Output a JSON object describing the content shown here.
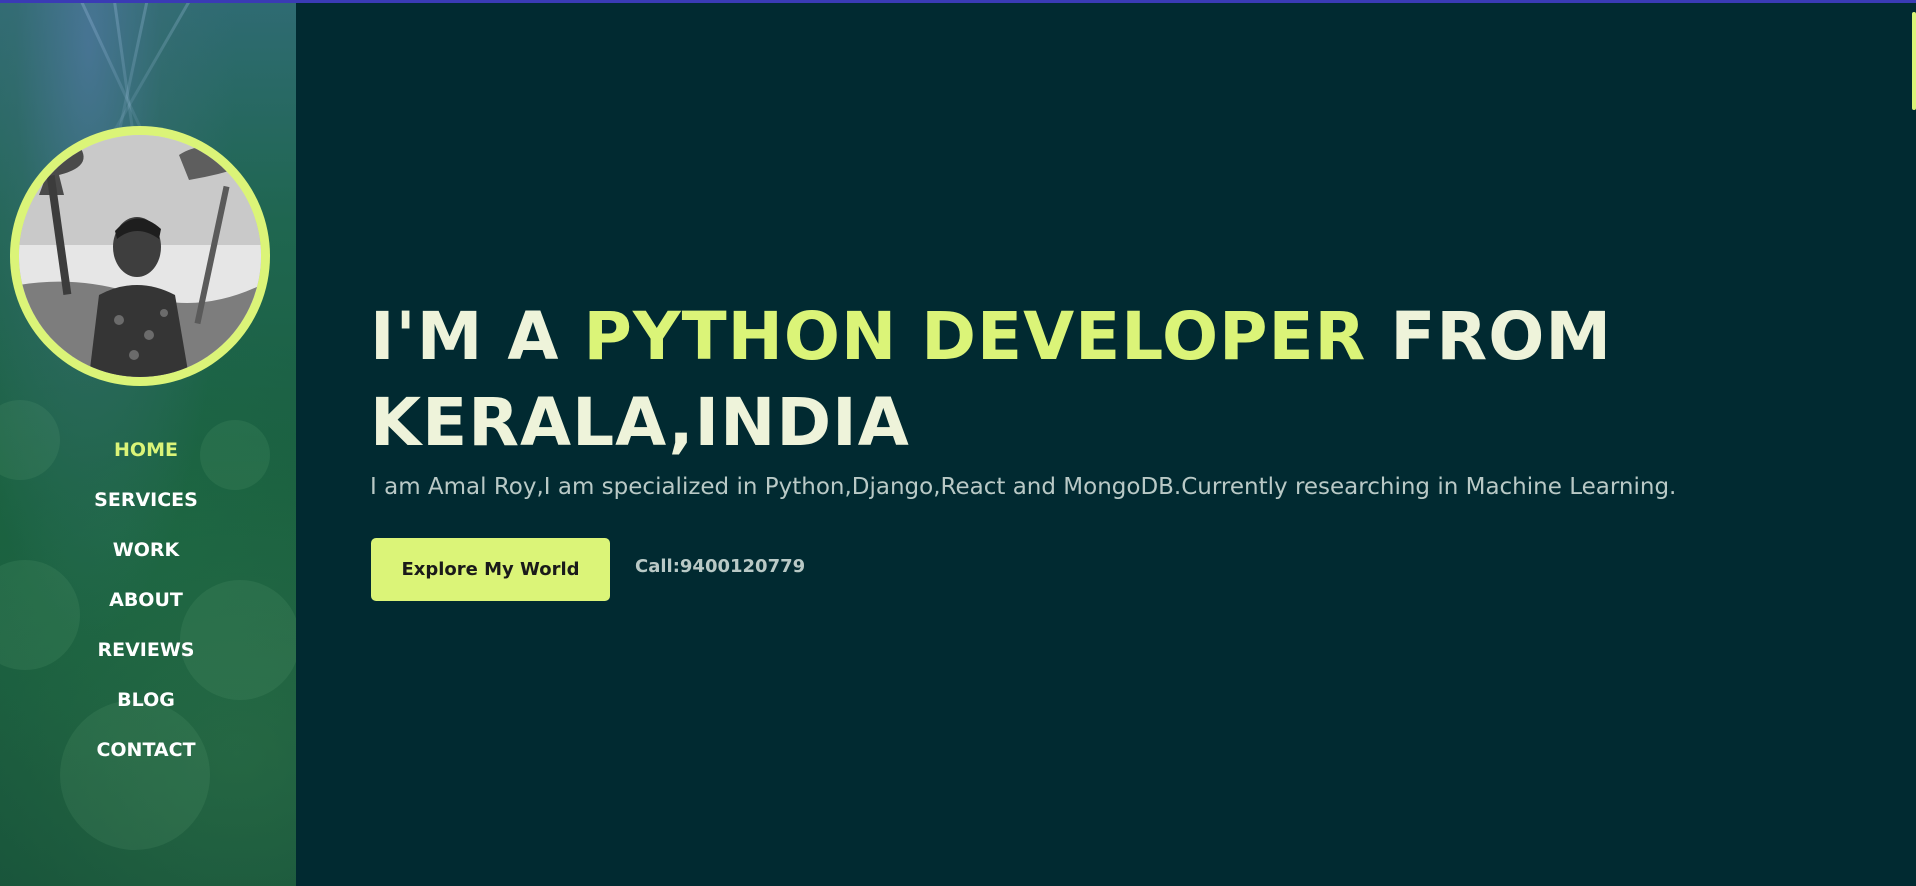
{
  "profile": {
    "photo": "portrait-photo"
  },
  "nav": {
    "items": [
      {
        "label": "HOME",
        "active": true
      },
      {
        "label": "SERVICES"
      },
      {
        "label": "WORK"
      },
      {
        "label": "ABOUT"
      },
      {
        "label": "REVIEWS"
      },
      {
        "label": "BLOG"
      },
      {
        "label": "CONTACT"
      }
    ]
  },
  "hero": {
    "headline_prefix": "I'M A ",
    "headline_accent": "PYTHON DEVELOPER",
    "headline_suffix": " FROM KERALA,INDIA",
    "subtitle": "I am Amal Roy,I am specialized in Python,Django,React and MongoDB.Currently researching in Machine Learning.",
    "cta_label": "Explore My World",
    "call_text": "Call:9400120779"
  },
  "colors": {
    "accent": "#dbf478",
    "background": "#012a31",
    "sidebar": "#1a5f3f",
    "text_light": "#eef3da",
    "text_muted": "#b9c9c6"
  }
}
